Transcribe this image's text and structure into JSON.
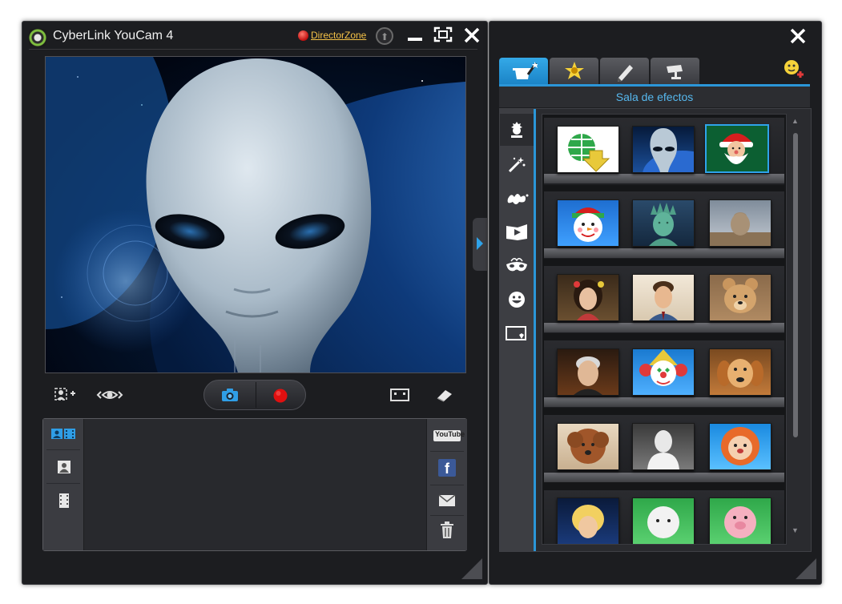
{
  "window": {
    "title": "CyberLink YouCam 4",
    "director_zone_label": "DirectorZone"
  },
  "toolbar": {
    "icons": [
      "add-face-tracking-icon",
      "eye-tracking-icon",
      "camera-icon",
      "record-icon",
      "screen-mode-icon",
      "eraser-icon"
    ]
  },
  "media_panel": {
    "view_icons": [
      "thumbnail-view-icon",
      "photo-filter-icon",
      "video-filter-icon"
    ],
    "share_labels": {
      "youtube": "YouTube"
    },
    "share_icons": [
      "youtube-icon",
      "facebook-icon",
      "email-icon",
      "trash-icon"
    ]
  },
  "effects_panel": {
    "section_title": "Sala de efectos",
    "tabs": [
      "magic-hat-icon",
      "sparkle-icon",
      "pencil-icon",
      "security-camera-icon"
    ],
    "categories": [
      "avatar-icon",
      "magic-wand-icon",
      "splash-icon",
      "frame-icon",
      "mask-icon",
      "emoticon-icon",
      "scene-icon"
    ],
    "effects": [
      [
        "download-more-effects",
        "alien",
        "santa-claus"
      ],
      [
        "snowman",
        "statue-of-liberty",
        "terracotta-warrior"
      ],
      [
        "woman-avatar",
        "man-avatar",
        "teddy-bear"
      ],
      [
        "old-man",
        "clown",
        "golden-retriever"
      ],
      [
        "poodle",
        "lincoln-bust",
        "lion-mask"
      ],
      [
        "blonde-hair",
        "sheep",
        "pig"
      ]
    ],
    "selected_effect": "santa-claus"
  },
  "colors": {
    "accent": "#2b96d8",
    "window_bg": "#1c1d20",
    "director_zone": "#f5c247",
    "record": "#e01010"
  }
}
